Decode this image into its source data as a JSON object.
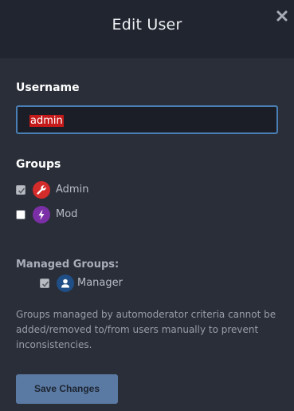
{
  "dialog": {
    "title": "Edit User",
    "close_icon": "close-icon"
  },
  "username": {
    "label": "Username",
    "value": "admin"
  },
  "groups": {
    "label": "Groups",
    "items": [
      {
        "name": "Admin",
        "checked": true,
        "icon": "wrench-icon",
        "color": "#d42b2b"
      },
      {
        "name": "Mod",
        "checked": false,
        "icon": "lightning-icon",
        "color": "#7b2fa6"
      }
    ]
  },
  "managed_groups": {
    "label": "Managed Groups:",
    "items": [
      {
        "name": "Manager",
        "checked": true,
        "icon": "user-icon",
        "color": "#1f4f86"
      }
    ],
    "help_text": "Groups managed by automoderator criteria cannot be added/removed to/from users manually to prevent inconsistencies."
  },
  "actions": {
    "save_label": "Save Changes"
  },
  "colors": {
    "background": "#2a2e38",
    "header": "#212530",
    "input_border": "#4a7fb5",
    "button": "#5a7aa3"
  }
}
